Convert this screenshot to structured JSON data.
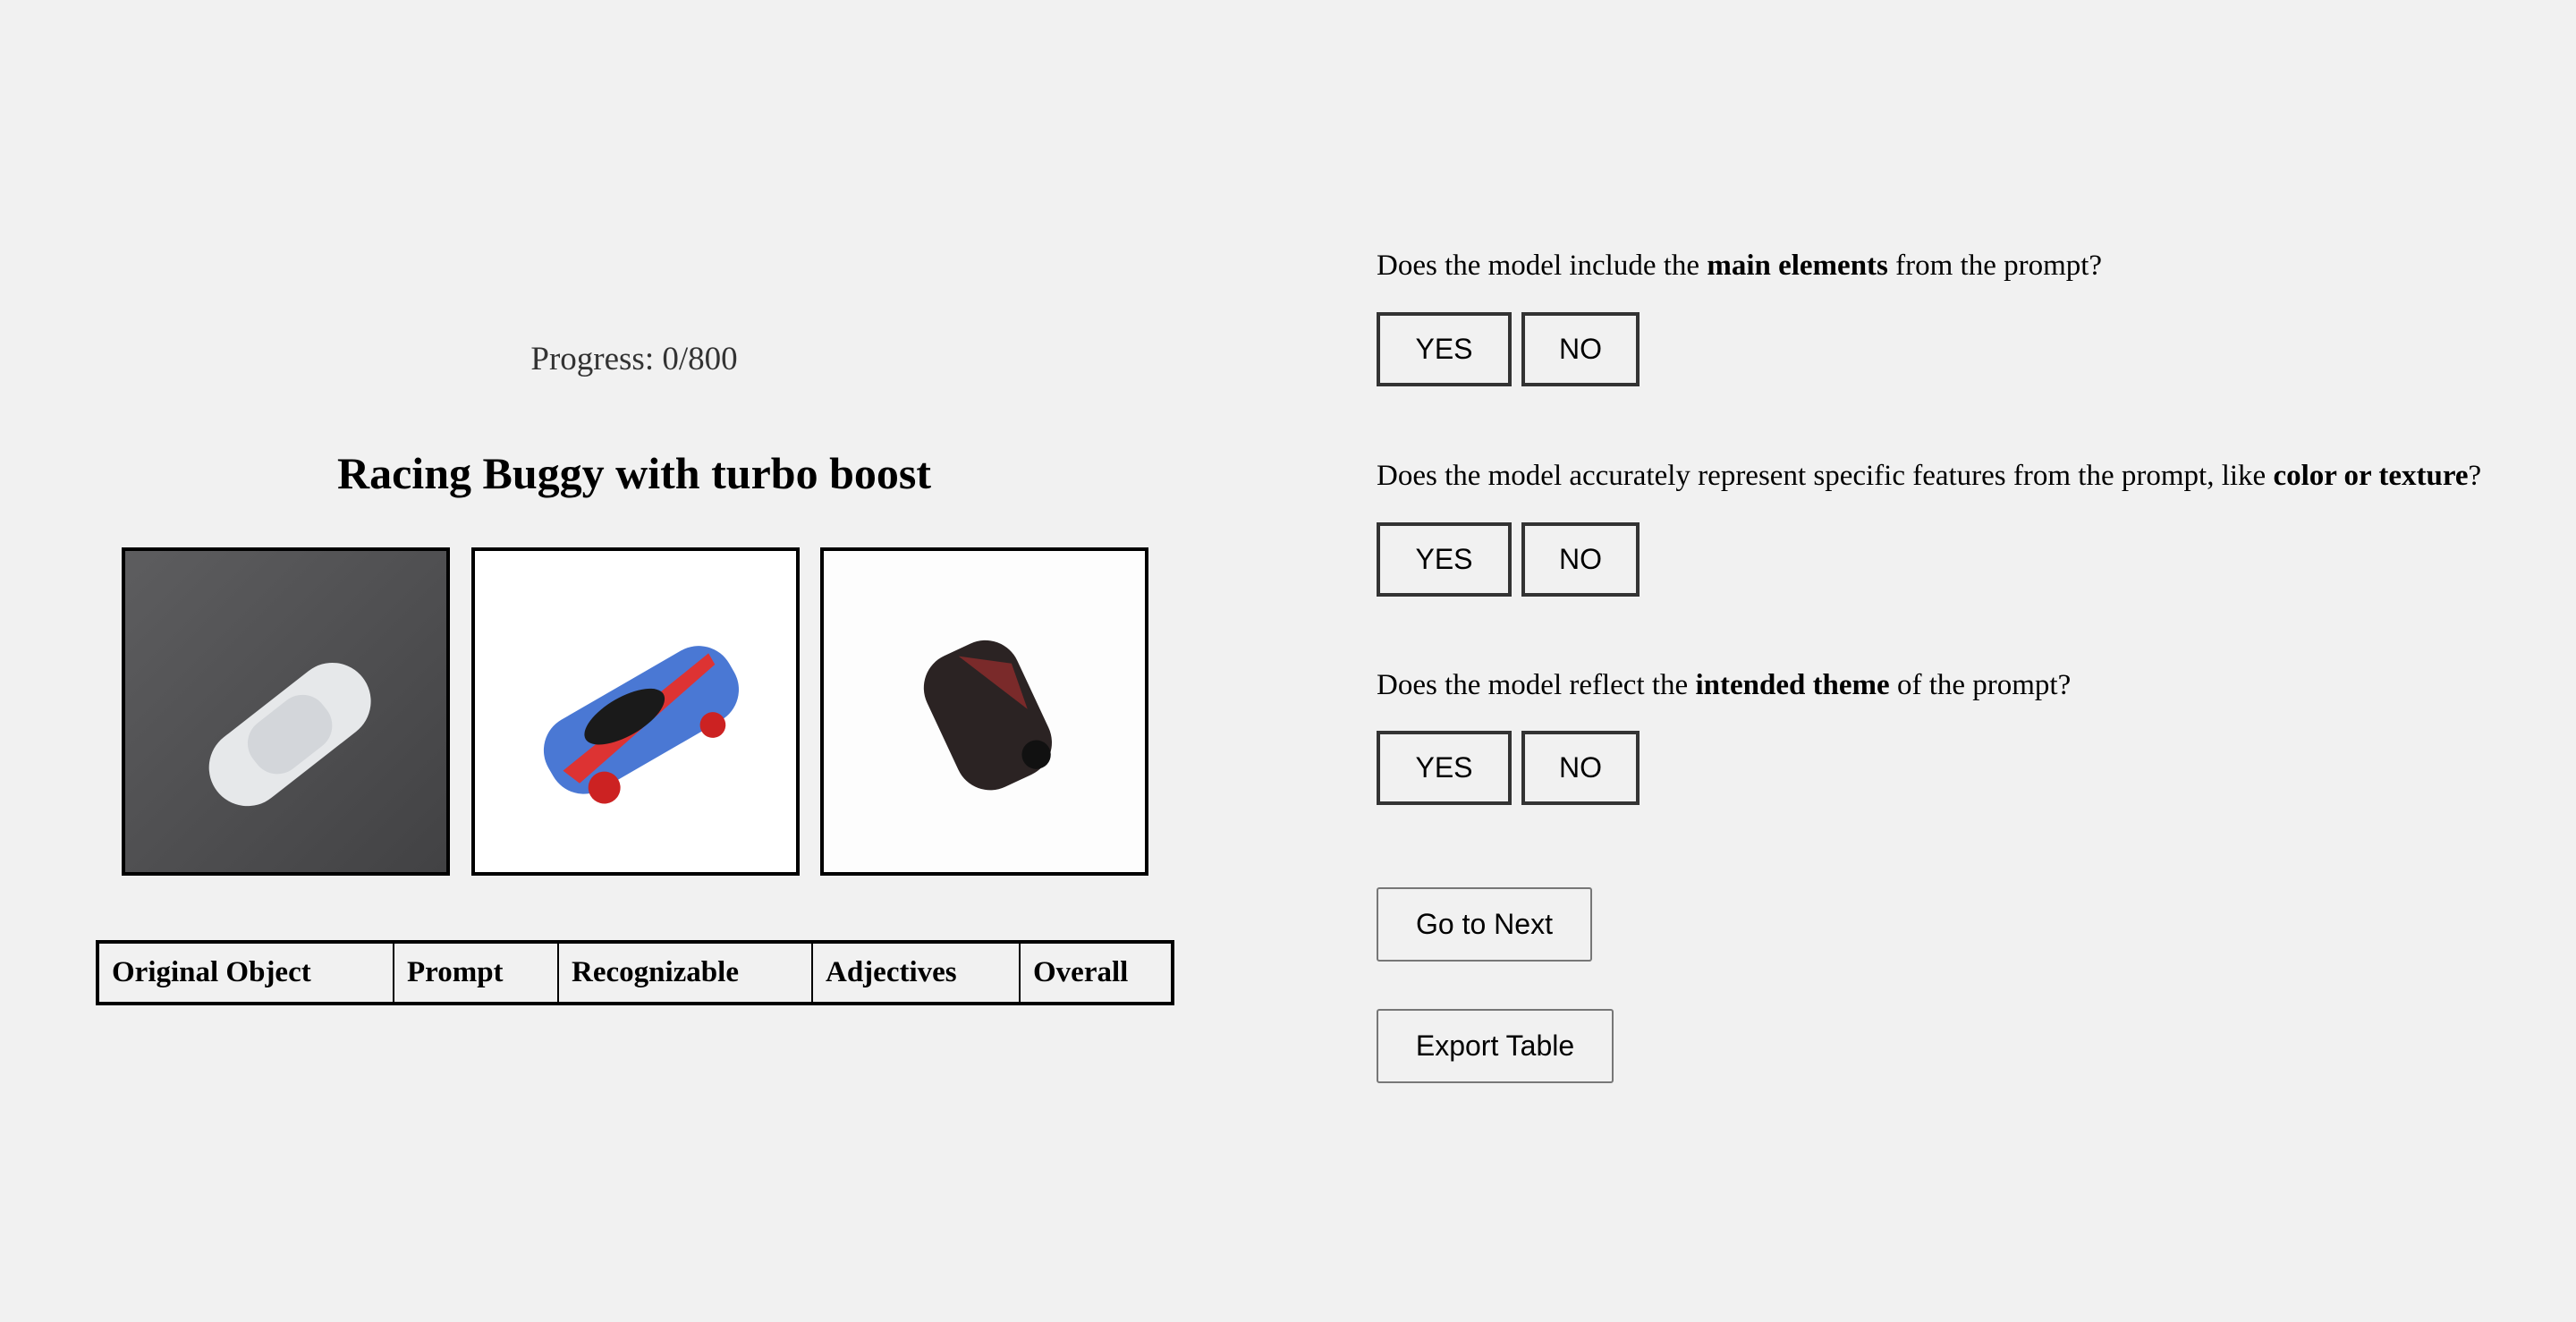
{
  "progress": {
    "label": "Progress: 0/800",
    "current": 0,
    "total": 800
  },
  "prompt_title": "Racing Buggy with turbo boost",
  "images": [
    {
      "icon": "white-car-render-on-asphalt"
    },
    {
      "icon": "blue-red-racing-car-render"
    },
    {
      "icon": "dark-blob-car-render"
    }
  ],
  "table": {
    "headers": [
      "Original Object",
      "Prompt",
      "Recognizable",
      "Adjectives",
      "Overall"
    ]
  },
  "questions": [
    {
      "pre": "Does the model include the ",
      "bold": "main elements",
      "post": " from the prompt?",
      "yes": "YES",
      "no": "NO"
    },
    {
      "pre": "Does the model accurately represent specific features from the prompt, like ",
      "bold": "color or texture",
      "post": "?",
      "yes": "YES",
      "no": "NO"
    },
    {
      "pre": "Does the model reflect the ",
      "bold": "intended theme",
      "post": " of the prompt?",
      "yes": "YES",
      "no": "NO"
    }
  ],
  "actions": {
    "next": "Go to Next",
    "export": "Export Table"
  }
}
